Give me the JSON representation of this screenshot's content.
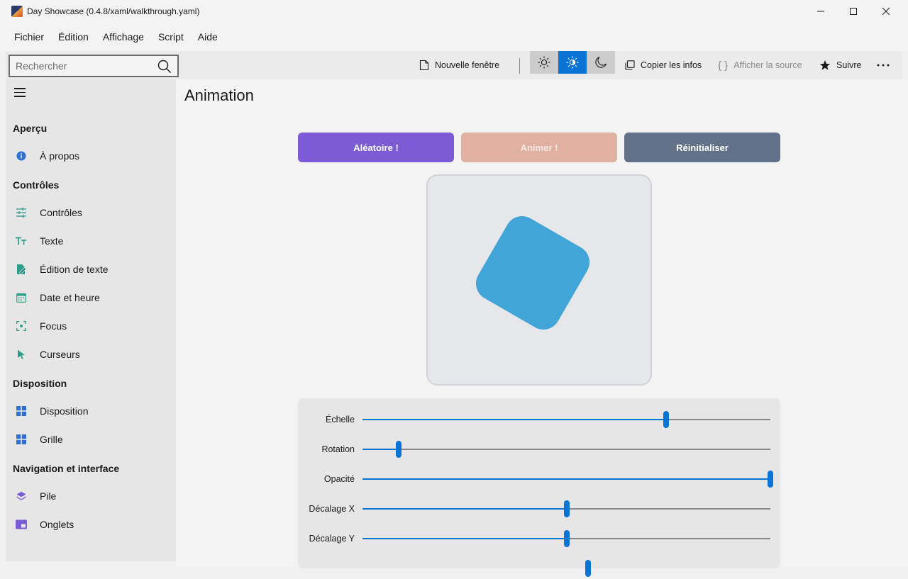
{
  "window": {
    "title": "Day Showcase (0.4.8/xaml/walkthrough.yaml)"
  },
  "menu": [
    "Fichier",
    "Édition",
    "Affichage",
    "Script",
    "Aide"
  ],
  "toolbar": {
    "search_placeholder": "Rechercher",
    "new_window": "Nouvelle fenêtre",
    "copy_info": "Copier les infos",
    "show_source": "Afficher la source",
    "follow": "Suivre",
    "theme_options": [
      "light",
      "auto",
      "dark"
    ],
    "theme_selected": "auto"
  },
  "sidebar": {
    "sections": [
      {
        "title": "Aperçu",
        "items": [
          {
            "label": "À propos",
            "icon": "info-icon"
          }
        ]
      },
      {
        "title": "Contrôles",
        "items": [
          {
            "label": "Contrôles",
            "icon": "sliders-icon"
          },
          {
            "label": "Texte",
            "icon": "text-size-icon"
          },
          {
            "label": "Édition de texte",
            "icon": "edit-document-icon"
          },
          {
            "label": "Date et heure",
            "icon": "calendar-icon"
          },
          {
            "label": "Focus",
            "icon": "focus-icon"
          },
          {
            "label": "Curseurs",
            "icon": "cursor-icon"
          }
        ]
      },
      {
        "title": "Disposition",
        "items": [
          {
            "label": "Disposition",
            "icon": "layout-grid-icon"
          },
          {
            "label": "Grille",
            "icon": "grid-icon"
          }
        ]
      },
      {
        "title": "Navigation et interface",
        "items": [
          {
            "label": "Pile",
            "icon": "stack-layers-icon"
          },
          {
            "label": "Onglets",
            "icon": "tabs-icon"
          }
        ]
      }
    ]
  },
  "page": {
    "title": "Animation",
    "buttons": {
      "random": "Aléatoire !",
      "animate": "Animer !",
      "reset": "Réinitialiser"
    },
    "colors": {
      "random": "#7b5cd6",
      "animate": "#e0b0a0",
      "reset": "#637188",
      "shape": "#42a5d8",
      "accent": "#0a74d6"
    },
    "sliders": [
      {
        "label": "Échelle",
        "value": 0.745
      },
      {
        "label": "Rotation",
        "value": 0.089
      },
      {
        "label": "Opacité",
        "value": 1.0
      },
      {
        "label": "Décalage X",
        "value": 0.5
      },
      {
        "label": "Décalage Y",
        "value": 0.5
      }
    ]
  }
}
